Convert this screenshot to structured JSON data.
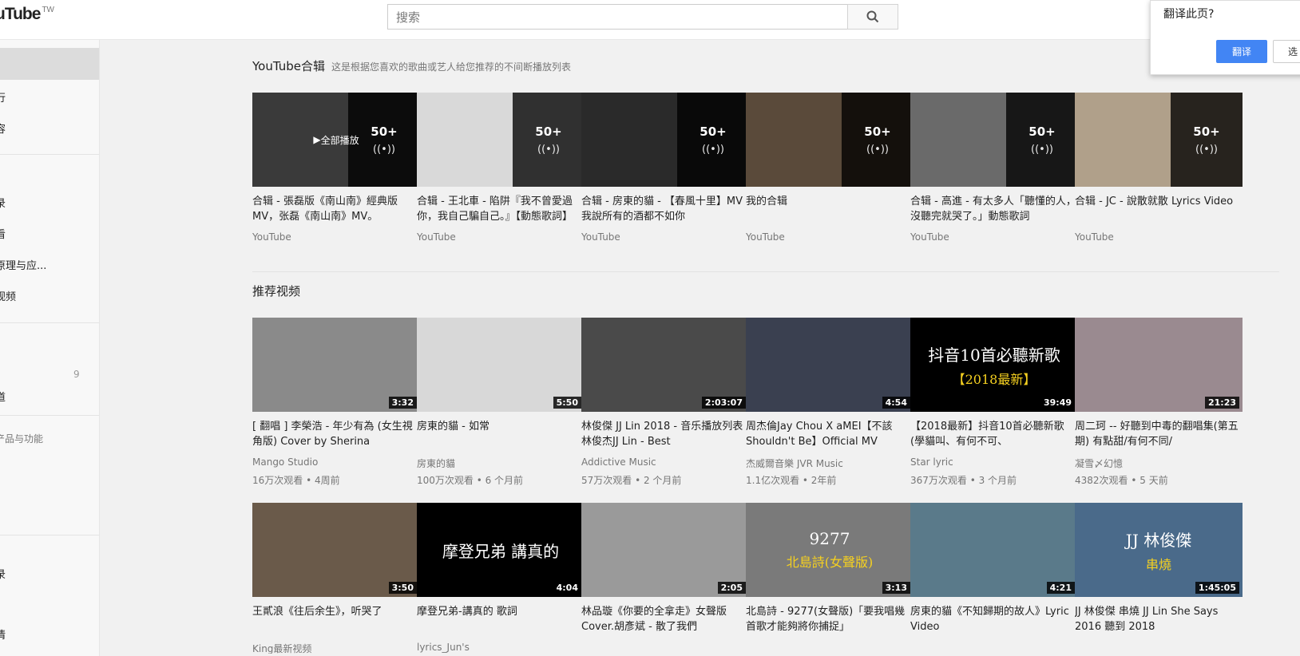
{
  "header": {
    "logo_text": "uTube",
    "logo_region": "TW",
    "search_placeholder": "搜索"
  },
  "translate_popup": {
    "title": "翻译此页?",
    "translate_label": "翻译",
    "other_label": "选"
  },
  "sidebar": {
    "items": [
      {
        "label": "行"
      },
      {
        "label": "容"
      },
      {
        "label": "录"
      },
      {
        "label": "看"
      },
      {
        "label": "原理与应..."
      },
      {
        "label": "视频"
      },
      {
        "label": "道"
      },
      {
        "label": "产品与功能"
      },
      {
        "label": "录"
      },
      {
        "label": "情"
      }
    ],
    "count": "9"
  },
  "mixes": {
    "title": "YouTube合辑",
    "subtitle": "这是根据您喜欢的歌曲或艺人给您推荐的不间断播放列表",
    "play_all": "全部播放",
    "items": [
      {
        "title": "合辑 - 張磊版《南山南》經典版MV，张磊《南山南》MV。",
        "channel": "YouTube",
        "count": "50+",
        "color": "#3a3a3a"
      },
      {
        "title": "合辑 - 王北車 - 陷阱『我不曾愛過你，我自己騙自己。』【動態歌詞】",
        "channel": "YouTube",
        "count": "50+",
        "color": "#d9d9d9"
      },
      {
        "title": "合辑 - 房東的貓 - 【春風十里】MV 我說所有的酒都不如你",
        "channel": "YouTube",
        "count": "50+",
        "color": "#2a2a2a"
      },
      {
        "title": "我的合辑",
        "channel": "YouTube",
        "count": "50+",
        "color": "#5a4a3a"
      },
      {
        "title": "合辑 - 高進 - 有太多人「聽懂的人，沒聽完就哭了。」動態歌詞",
        "channel": "YouTube",
        "count": "50+",
        "color": "#6a6a6a"
      },
      {
        "title": "合辑 - JC - 說散就散 Lyrics Video",
        "channel": "YouTube",
        "count": "50+",
        "color": "#b0a08a"
      }
    ]
  },
  "recommended": {
    "title": "推荐视频",
    "row1": [
      {
        "title": "[ 翻唱 ] 李榮浩 - 年少有為 (女生視角版) Cover by Sherina",
        "channel": "Mango Studio",
        "meta": "16万次观看 • 4周前",
        "duration": "3:32",
        "color": "#8a8a8a"
      },
      {
        "title": "房東的貓 - 如常",
        "channel": "房東的貓",
        "meta": "100万次观看 • 6 个月前",
        "duration": "5:50",
        "color": "#d8d8d8"
      },
      {
        "title": "林俊傑 JJ Lin 2018 - 音乐播放列表林俊杰JJ Lin - Best",
        "channel": "Addictive Music",
        "meta": "57万次观看 • 2 个月前",
        "duration": "2:03:07",
        "color": "#4a4a4a"
      },
      {
        "title": "周杰倫Jay Chou X aMEI【不該 Shouldn't Be】Official MV",
        "channel": "杰威爾音樂 JVR Music",
        "meta": "1.1亿次观看 • 2年前",
        "duration": "4:54",
        "color": "#3a4050"
      },
      {
        "title": "【2018最新】抖音10首必聽新歌 (學貓叫、有何不可、",
        "channel": "Star lyric",
        "meta": "367万次观看 • 3 个月前",
        "duration": "39:49",
        "color": "#000000",
        "overlay1": "抖音10首必聽新歌",
        "overlay2": "【2018最新】"
      },
      {
        "title": "周二珂 -- 好聽到中毒的翻唱集(第五期) 有點甜/有何不同/",
        "channel": "凝雪〆幻憶",
        "meta": "4382次观看 • 5 天前",
        "duration": "21:23",
        "color": "#9a8a90"
      }
    ],
    "row2": [
      {
        "title": "王貳浪《往后余生》，听哭了",
        "channel": "King最新视频",
        "meta": "",
        "duration": "3:50",
        "color": "#6a5a4a"
      },
      {
        "title": "摩登兄弟-講真的 歌詞",
        "channel": "lyrics_Jun's",
        "meta": "",
        "duration": "4:04",
        "color": "#000000",
        "overlay1": "摩登兄弟  講真的"
      },
      {
        "title": "林品璇《你要的全拿走》女聲版 Cover.胡彥斌 - 散了我們",
        "channel": "",
        "meta": "",
        "duration": "2:05",
        "color": "#9a9a9a"
      },
      {
        "title": "北島詩 - 9277(女聲版)「要我唱幾首歌才能夠將你捕捉」",
        "channel": "",
        "meta": "",
        "duration": "3:13",
        "color": "#7a7a7a",
        "overlay1": "9277",
        "overlay2": "北島詩(女聲版)"
      },
      {
        "title": "房東的貓《不知歸期的故人》Lyric Video",
        "channel": "",
        "meta": "",
        "duration": "4:21",
        "color": "#5a7a8a"
      },
      {
        "title": "JJ 林俊傑 串燒 JJ Lin She Says 2016 聽到 2018",
        "channel": "",
        "meta": "",
        "duration": "1:45:05",
        "color": "#4a6a8a",
        "overlay1": "JJ 林俊傑",
        "overlay2": "串燒"
      }
    ]
  }
}
